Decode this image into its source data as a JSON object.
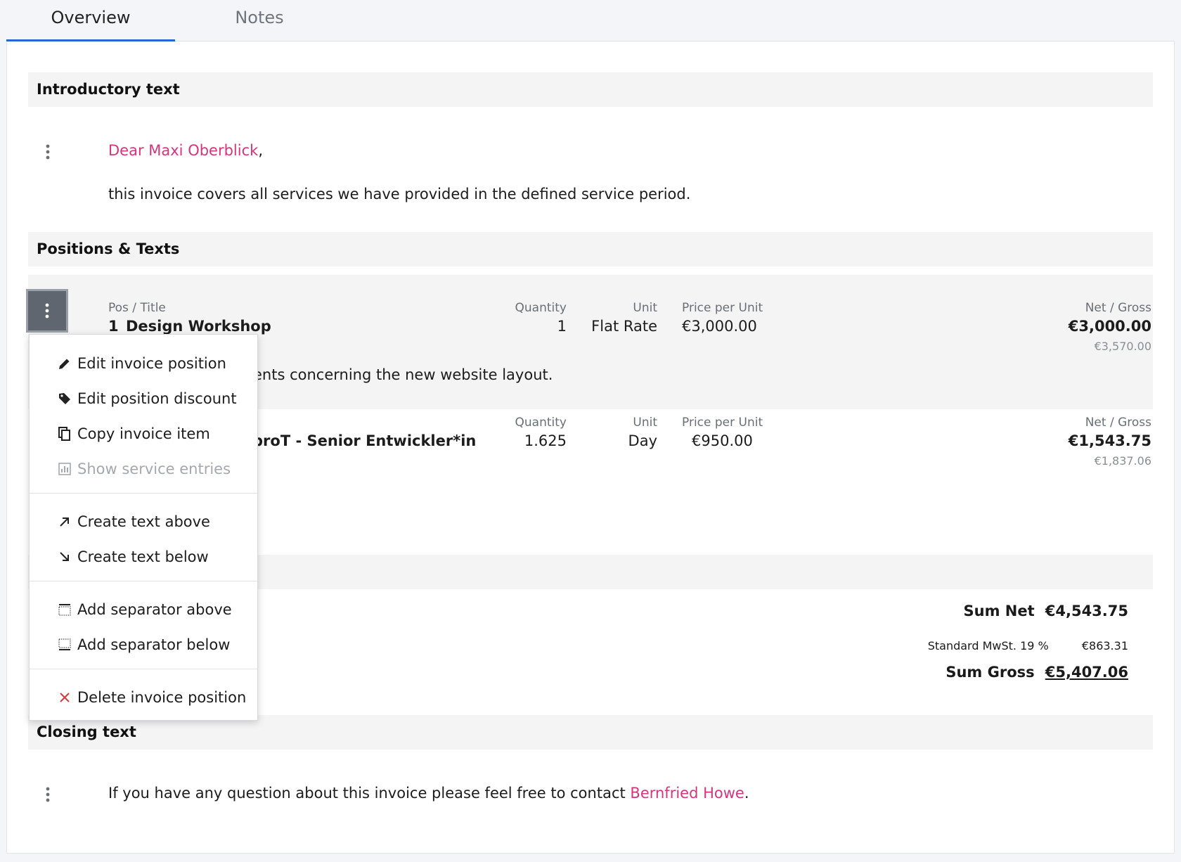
{
  "tabs": [
    {
      "label": "Overview",
      "active": true
    },
    {
      "label": "Notes",
      "active": false
    }
  ],
  "sections": {
    "intro_title": "Introductory text",
    "positions_title": "Positions & Texts",
    "closing_title": "Closing text"
  },
  "intro": {
    "greeting_name": "Dear Maxi Oberblick",
    "greeting_comma": ",",
    "body": "this invoice covers all services we have provided in the defined service period."
  },
  "columns": {
    "pos_title": "Pos / Title",
    "quantity": "Quantity",
    "unit": "Unit",
    "price_per_unit": "Price per Unit",
    "net_gross": "Net / Gross"
  },
  "positions": [
    {
      "number": "1",
      "title": "Design Workshop",
      "quantity": "1",
      "unit": "Flat Rate",
      "price": "€3,000.00",
      "net": "€3,000.00",
      "gross": "€3,570.00",
      "description_visible": "ents concerning the new website layout."
    },
    {
      "title_visible": "proT - Senior Entwickler*in",
      "quantity": "1.625",
      "unit": "Day",
      "price": "€950.00",
      "net": "€1,543.75",
      "gross": "€1,837.06"
    }
  ],
  "totals": {
    "sum_net_label": "Sum Net",
    "sum_net_value": "€4,543.75",
    "tax_label": "Standard MwSt. 19 %",
    "tax_value": "€863.31",
    "sum_gross_label": "Sum Gross",
    "sum_gross_value": "€5,407.06"
  },
  "closing": {
    "text_before": "If you have any question about this invoice please feel free to contact ",
    "contact_name": "Bernfried Howe",
    "text_after": "."
  },
  "context_menu": {
    "items": [
      {
        "label": "Edit invoice position",
        "icon": "pencil-icon"
      },
      {
        "label": "Edit position discount",
        "icon": "tag-icon"
      },
      {
        "label": "Copy invoice item",
        "icon": "copy-icon"
      },
      {
        "label": "Show service entries",
        "icon": "chart-icon",
        "disabled": true
      },
      {
        "label": "Create text above",
        "icon": "arrow-up-right-icon"
      },
      {
        "label": "Create text below",
        "icon": "arrow-down-right-icon"
      },
      {
        "label": "Add separator above",
        "icon": "separator-above-icon"
      },
      {
        "label": "Add separator below",
        "icon": "separator-below-icon"
      },
      {
        "label": "Delete invoice position",
        "icon": "close-icon",
        "danger": true
      }
    ]
  },
  "colors": {
    "accent": "#2565d9",
    "link": "#d6357d",
    "danger": "#d83a3a"
  }
}
